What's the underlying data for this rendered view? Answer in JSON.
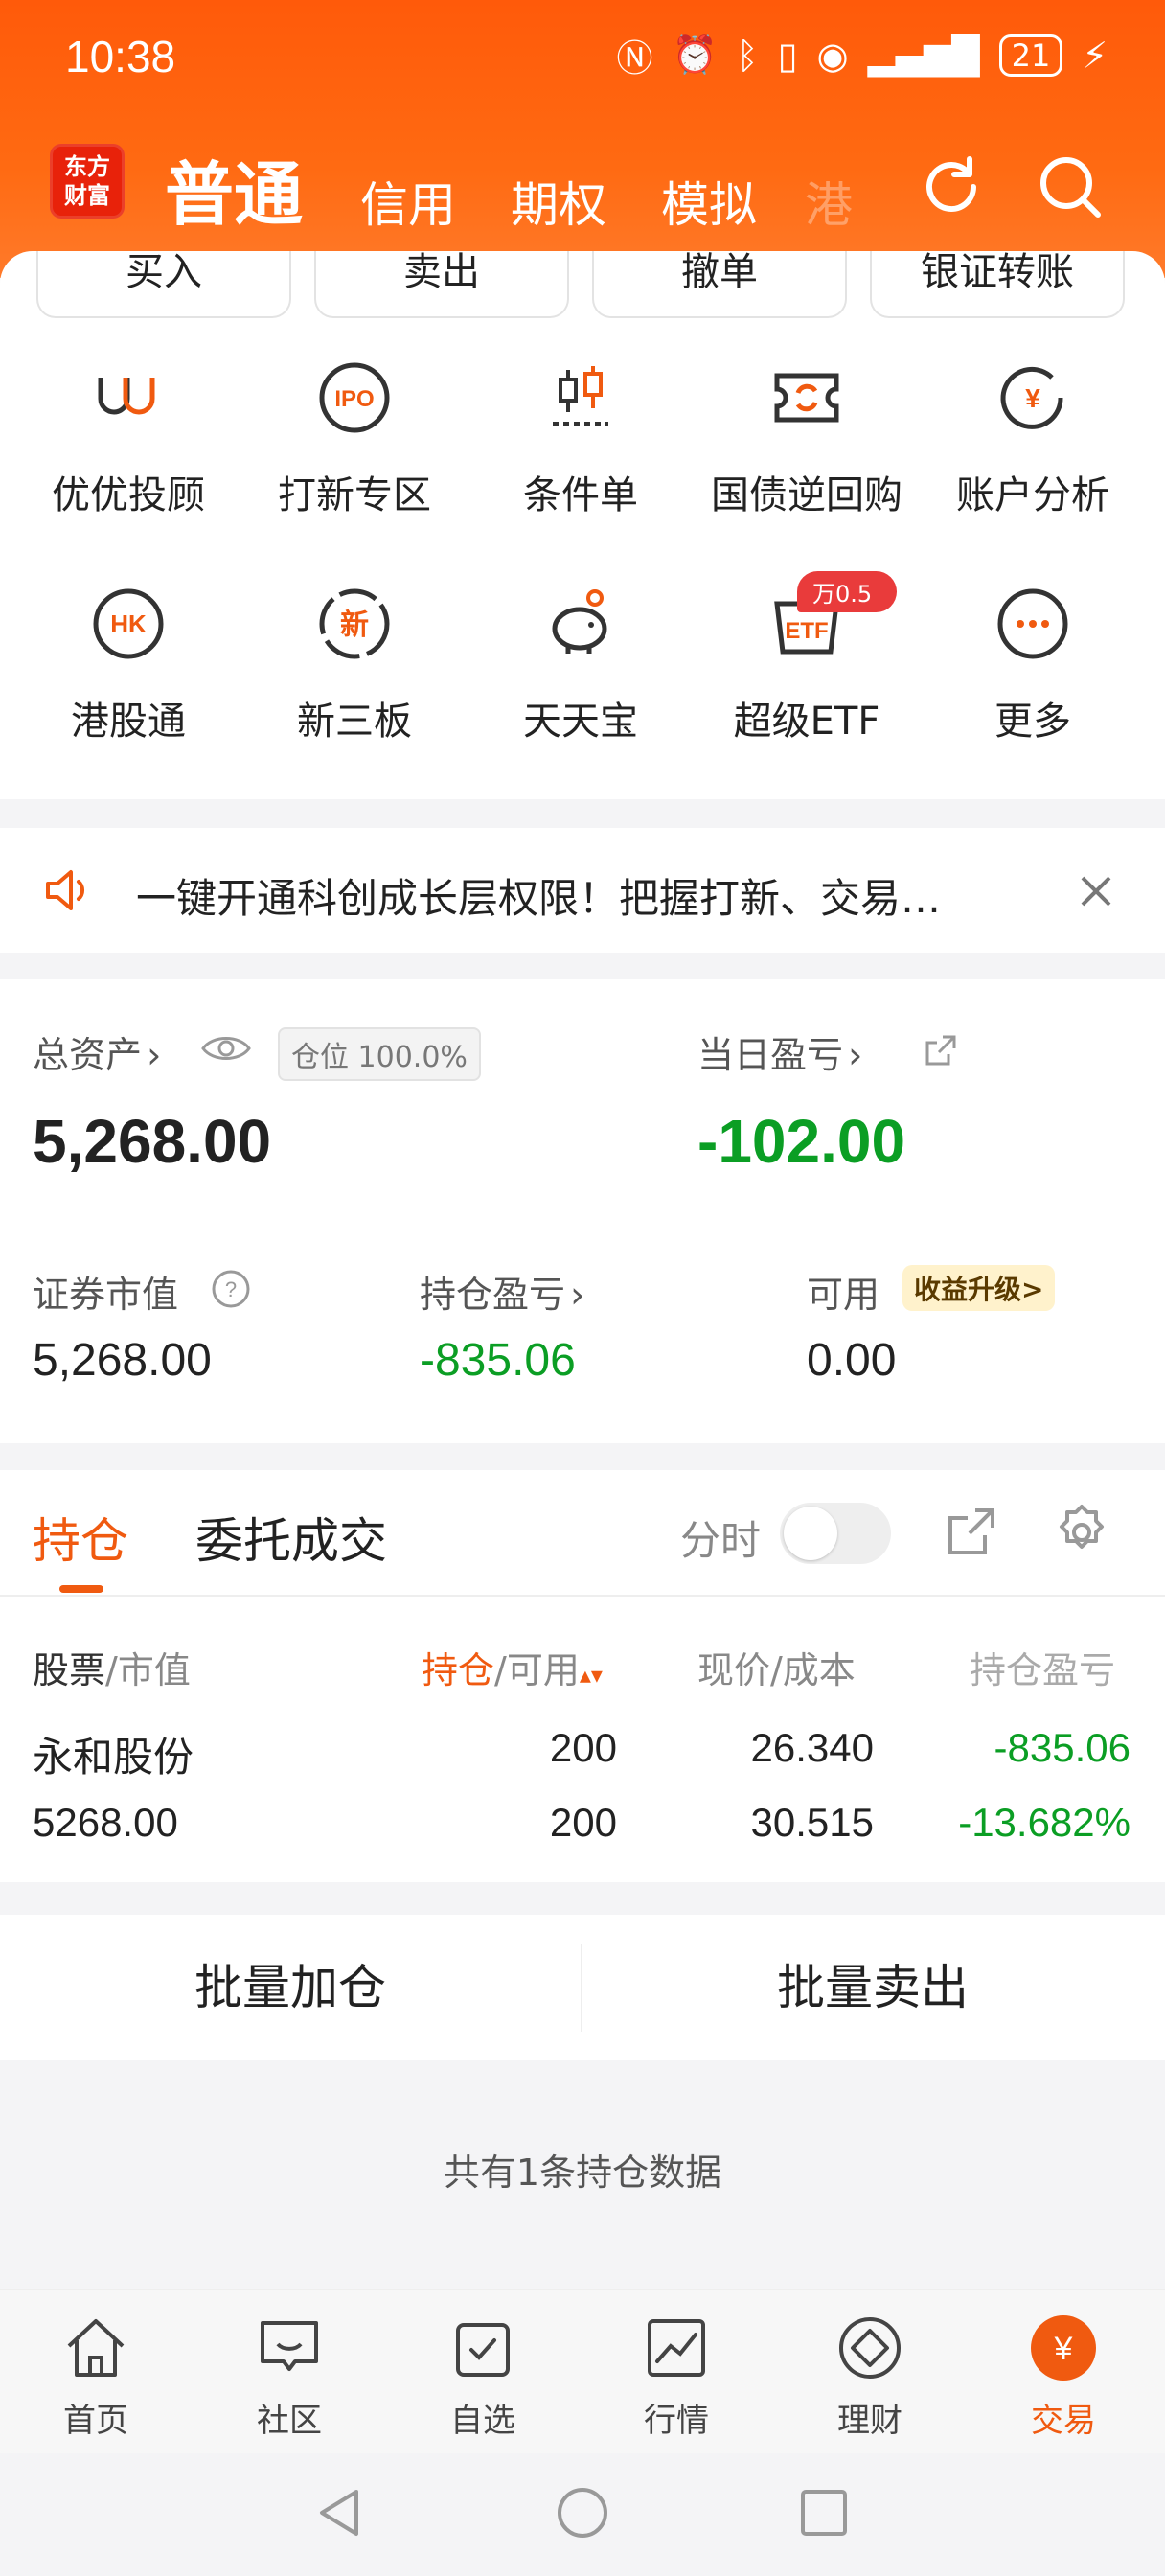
{
  "status": {
    "time": "10:38",
    "battery": "21"
  },
  "header": {
    "logo_text": "东方\n财富",
    "tabs": [
      "普通",
      "信用",
      "期权",
      "模拟",
      "港"
    ]
  },
  "actions": [
    "买入",
    "卖出",
    "撤单",
    "银证转账"
  ],
  "grid": [
    {
      "label": "优优投顾",
      "icon": "uu-advisor-icon"
    },
    {
      "label": "打新专区",
      "icon": "ipo-icon"
    },
    {
      "label": "条件单",
      "icon": "condition-order-icon"
    },
    {
      "label": "国债逆回购",
      "icon": "reverse-repo-icon"
    },
    {
      "label": "账户分析",
      "icon": "account-analysis-icon"
    },
    {
      "label": "港股通",
      "icon": "hk-connect-icon"
    },
    {
      "label": "新三板",
      "icon": "new-third-board-icon"
    },
    {
      "label": "天天宝",
      "icon": "piggy-bank-icon"
    },
    {
      "label": "超级ETF",
      "icon": "etf-icon"
    },
    {
      "label": "更多",
      "icon": "more-icon"
    }
  ],
  "badge": "万0.5",
  "notice": {
    "text": "一键开通科创成长层权限！把握打新、交易…"
  },
  "assets": {
    "total_label": "总资产",
    "position_pill": "仓位 100.0%",
    "total_value": "5,268.00",
    "daily_label": "当日盈亏",
    "daily_value": "-102.00",
    "market_value_label": "证券市值",
    "market_value": "5,268.00",
    "holding_pl_label": "持仓盈亏",
    "holding_pl": "-835.06",
    "available_label": "可用",
    "upgrade_label": "收益升级>",
    "available": "0.00"
  },
  "positions": {
    "tab_active": "持仓",
    "tab_other": "委托成交",
    "toggle_label": "分时",
    "headers": {
      "stock": "股票",
      "stock_sub": "/市值",
      "hold": "持仓",
      "hold_sub": "/可用",
      "price": "现价/成本",
      "pl": "持仓盈亏"
    },
    "rows": [
      {
        "name": "永和股份",
        "market_value": "5268.00",
        "hold": "200",
        "available": "200",
        "price": "26.340",
        "cost": "30.515",
        "pl": "-835.06",
        "pl_pct": "-13.682%"
      }
    ]
  },
  "batch": {
    "add": "批量加仓",
    "sell": "批量卖出"
  },
  "summary": "共有1条持仓数据",
  "bottom_nav": [
    {
      "label": "首页",
      "icon": "home-icon"
    },
    {
      "label": "社区",
      "icon": "community-icon"
    },
    {
      "label": "自选",
      "icon": "watchlist-icon"
    },
    {
      "label": "行情",
      "icon": "market-icon"
    },
    {
      "label": "理财",
      "icon": "wealth-icon"
    },
    {
      "label": "交易",
      "icon": "trade-icon"
    }
  ],
  "colors": {
    "brand": "#ff5a0a",
    "loss": "#0b9e24",
    "active": "#f05a10"
  }
}
